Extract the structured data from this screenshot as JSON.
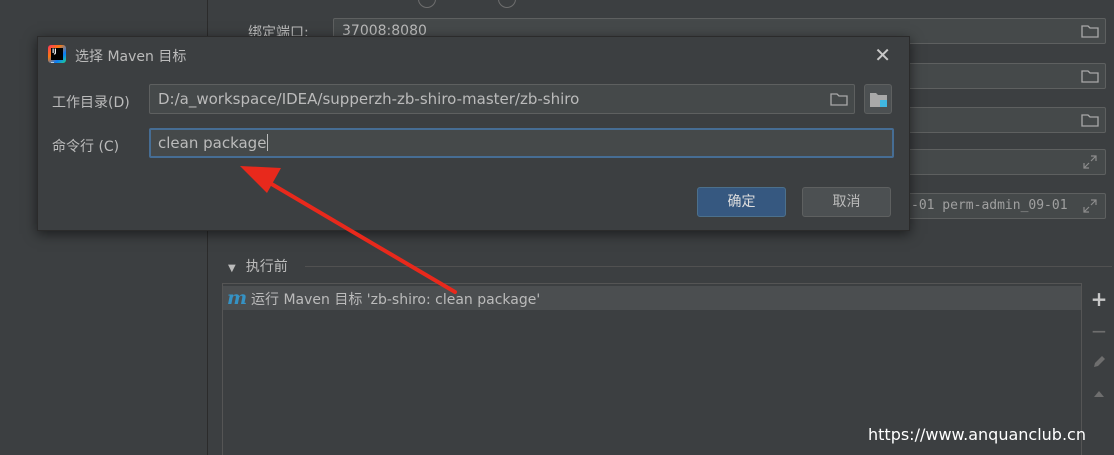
{
  "background": {
    "top_label_partial": "绑定端口:",
    "port_value": "37008:8080",
    "row5_value_partial": "-01 perm-admin_09-01"
  },
  "section": {
    "title": "执行前"
  },
  "task_list": {
    "items": [
      {
        "label": "运行 Maven 目标 'zb-shiro: clean package'"
      }
    ]
  },
  "dialog": {
    "title": "选择 Maven 目标",
    "working_dir_label": "工作目录(D)",
    "working_dir_value": "D:/a_workspace/IDEA/supperzh-zb-shiro-master/zb-shiro",
    "command_label": "命令行 (C)",
    "command_value": "clean package",
    "ok_label": "确定",
    "cancel_label": "取消"
  },
  "watermark": "https://www.anquanclub.cn",
  "colors": {
    "accent": "#365880",
    "focus_border": "#466d94",
    "arrow": "#e8291c",
    "maven_icon": "#3592c4"
  }
}
